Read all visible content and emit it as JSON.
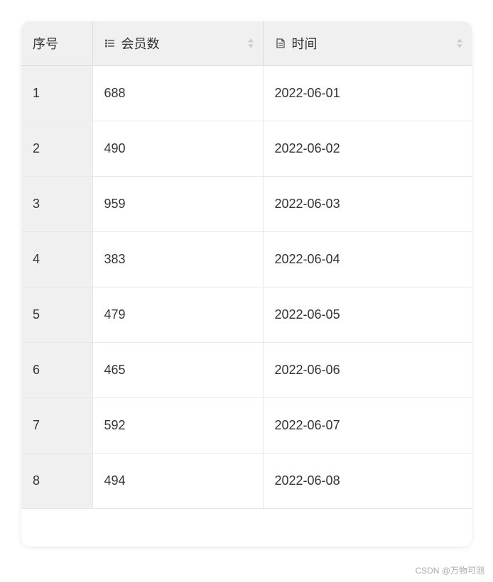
{
  "table": {
    "columns": [
      {
        "key": "index",
        "label": "序号",
        "icon": null,
        "sortable": false
      },
      {
        "key": "members",
        "label": "会员数",
        "icon": "list",
        "sortable": true
      },
      {
        "key": "time",
        "label": "时间",
        "icon": "document",
        "sortable": true
      }
    ],
    "rows": [
      {
        "index": "1",
        "members": "688",
        "time": "2022-06-01"
      },
      {
        "index": "2",
        "members": "490",
        "time": "2022-06-02"
      },
      {
        "index": "3",
        "members": "959",
        "time": "2022-06-03"
      },
      {
        "index": "4",
        "members": "383",
        "time": "2022-06-04"
      },
      {
        "index": "5",
        "members": "479",
        "time": "2022-06-05"
      },
      {
        "index": "6",
        "members": "465",
        "time": "2022-06-06"
      },
      {
        "index": "7",
        "members": "592",
        "time": "2022-06-07"
      },
      {
        "index": "8",
        "members": "494",
        "time": "2022-06-08"
      }
    ]
  },
  "watermark": "CSDN @万物可测"
}
